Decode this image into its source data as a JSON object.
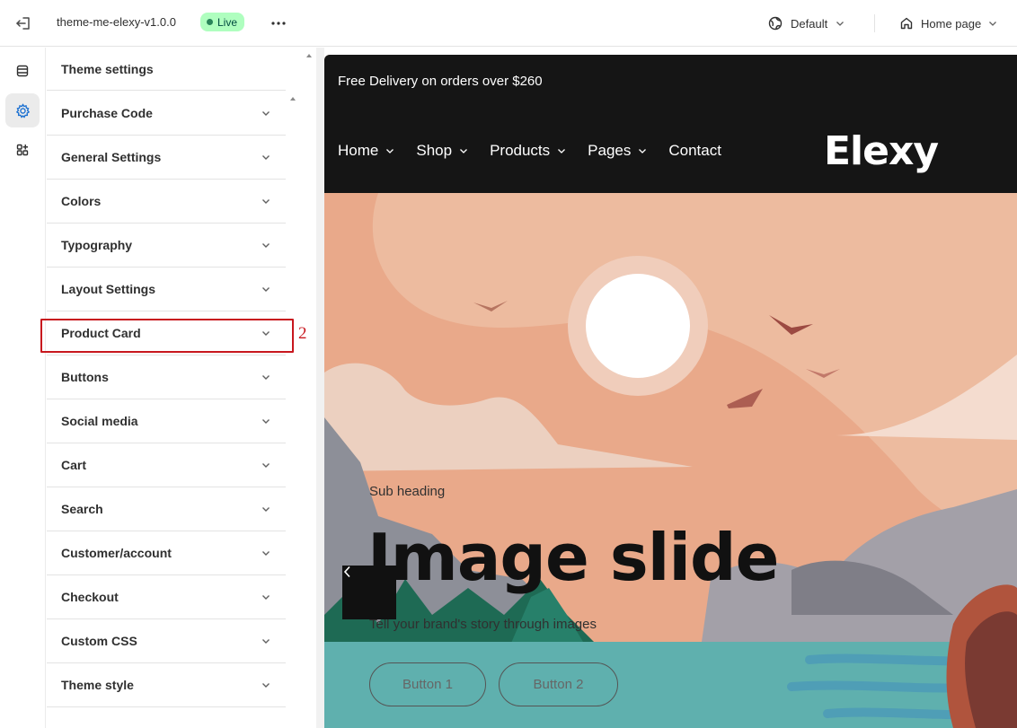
{
  "topbar": {
    "theme_name": "theme-me-elexy-v1.0.0",
    "status_badge": "Live",
    "language_select": "Default",
    "page_select": "Home page"
  },
  "rail": {
    "items": [
      "sections-icon",
      "gear-icon",
      "apps-icon"
    ],
    "active": "gear-icon"
  },
  "panel": {
    "title": "Theme settings",
    "items": [
      {
        "label": "Purchase Code"
      },
      {
        "label": "General Settings"
      },
      {
        "label": "Colors"
      },
      {
        "label": "Typography"
      },
      {
        "label": "Layout Settings"
      },
      {
        "label": "Product Card"
      },
      {
        "label": "Buttons"
      },
      {
        "label": "Social media"
      },
      {
        "label": "Cart"
      },
      {
        "label": "Search"
      },
      {
        "label": "Customer/account"
      },
      {
        "label": "Checkout"
      },
      {
        "label": "Custom CSS"
      },
      {
        "label": "Theme style"
      }
    ],
    "highlighted_item": "Product Card",
    "annotation": "2"
  },
  "preview": {
    "announcement": "Free Delivery on orders over $260",
    "nav": [
      {
        "label": "Home",
        "has_dropdown": true
      },
      {
        "label": "Shop",
        "has_dropdown": true
      },
      {
        "label": "Products",
        "has_dropdown": true
      },
      {
        "label": "Pages",
        "has_dropdown": true
      },
      {
        "label": "Contact",
        "has_dropdown": false
      }
    ],
    "logo": "Elexy",
    "slide": {
      "sub_heading": "Sub heading",
      "title": "Image slide",
      "text": "Tell your brand's story through images",
      "button1": "Button 1",
      "button2": "Button 2"
    }
  },
  "colors": {
    "live_bg": "#affebf",
    "highlight": "#c8171e",
    "header_bg": "#151515"
  }
}
